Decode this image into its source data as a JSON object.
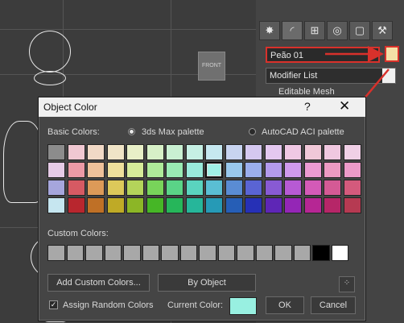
{
  "viewport": {
    "front_label": "FRONT"
  },
  "command_panel": {
    "tabs": [
      {
        "name": "create",
        "glyph": "✸"
      },
      {
        "name": "modify",
        "glyph": "◜"
      },
      {
        "name": "hierarchy",
        "glyph": "⊞"
      },
      {
        "name": "motion",
        "glyph": "◎"
      },
      {
        "name": "display",
        "glyph": "▢"
      },
      {
        "name": "utilities",
        "glyph": "⚒"
      }
    ],
    "object_name": "Peão 01",
    "object_color": "#f4e0a6",
    "modifier_list": "Modifier List",
    "stack_item": "Editable Mesh"
  },
  "dialog": {
    "title": "Object Color",
    "help": "?",
    "close": "✕",
    "basic_colors_label": "Basic Colors:",
    "palette_options": [
      "3ds Max palette",
      "AutoCAD ACI palette"
    ],
    "selected_palette": "3ds Max palette",
    "basic_colors": [
      [
        "#8c8c8c",
        "#f0c8d2",
        "#f1d9c6",
        "#f0e4c7",
        "#e8efc7",
        "#d7f0c7",
        "#c9f0d2",
        "#c6f0e4",
        "#c6e8f0",
        "#c8d4f0",
        "#d5c8f0",
        "#e4c8f0",
        "#f0c8e4",
        "#f0c8d8",
        "#f0c8e0",
        "#f0d0e6"
      ],
      [
        "#e6cbe6",
        "#ec9aa6",
        "#eec19a",
        "#eedf9c",
        "#d6eb99",
        "#aeea99",
        "#99eab3",
        "#99eadb",
        "#a0f0e6",
        "#99c8ec",
        "#9aaeec",
        "#b39aec",
        "#cf9aec",
        "#ec9ad2",
        "#ec9ac2",
        "#ec9ac8"
      ],
      [
        "#a6a6dc",
        "#d65a63",
        "#dc9a58",
        "#dcc95a",
        "#b4d45a",
        "#78d45a",
        "#5ad487",
        "#5ad4bf",
        "#5abed4",
        "#5a8cd4",
        "#5a64d4",
        "#885ad4",
        "#b75ad4",
        "#d45ab7",
        "#d45a95",
        "#d45a7c"
      ],
      [
        "#c6e6f0",
        "#b8262e",
        "#bf7026",
        "#bfaa26",
        "#8cb626",
        "#46b626",
        "#26b65a",
        "#26b69a",
        "#269ab6",
        "#265eb6",
        "#2630b6",
        "#5e26b6",
        "#9426b6",
        "#b62694",
        "#b62668",
        "#b63a52"
      ]
    ],
    "selected_cell": {
      "row": 1,
      "col": 8
    },
    "custom_colors_label": "Custom Colors:",
    "custom_colors": [
      "#a8a8a8",
      "#a8a8a8",
      "#a8a8a8",
      "#a8a8a8",
      "#a8a8a8",
      "#a8a8a8",
      "#a8a8a8",
      "#a8a8a8",
      "#a8a8a8",
      "#a8a8a8",
      "#a8a8a8",
      "#a8a8a8",
      "#a8a8a8",
      "#a8a8a8",
      "#000000",
      "#ffffff"
    ],
    "add_custom_label": "Add Custom Colors...",
    "by_object_label": "By Object",
    "assign_random_label": "Assign Random Colors",
    "assign_random_checked": "✓",
    "current_color_label": "Current Color:",
    "current_color": "#98f0e1",
    "ok_label": "OK",
    "cancel_label": "Cancel",
    "pick_icon": "⁘"
  }
}
